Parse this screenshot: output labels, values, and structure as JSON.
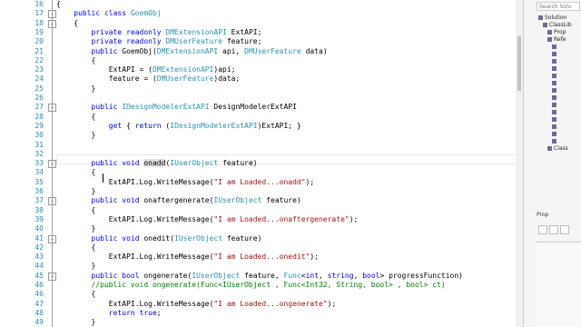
{
  "editor": {
    "lines": [
      {
        "n": "16",
        "html": "{"
      },
      {
        "n": "17",
        "html": "    <span class='kw'>public class</span> <span class='ty'>GoemObj</span>"
      },
      {
        "n": "18",
        "html": "    {"
      },
      {
        "n": "19",
        "html": "        <span class='kw'>private readonly</span> <span class='ty'>DMExtensionAPI</span> ExtAPI;"
      },
      {
        "n": "20",
        "html": "        <span class='kw'>private readonly</span> <span class='ty'>DMUserFeature</span> feature;"
      },
      {
        "n": "21",
        "html": "        <span class='kw'>public</span> GoemObj(<span class='ty'>DMExtensionAPI</span> api, <span class='ty'>DMUserFeature</span> data)"
      },
      {
        "n": "22",
        "html": "        {"
      },
      {
        "n": "23",
        "html": "            ExtAPI = (<span class='ty'>DMExtensionAPI</span>)api;"
      },
      {
        "n": "24",
        "html": "            feature = (<span class='ty'>DMUserFeature</span>)data;"
      },
      {
        "n": "25",
        "html": "        }"
      },
      {
        "n": "26",
        "html": ""
      },
      {
        "n": "27",
        "html": "        <span class='kw'>public</span> <span class='ty'>IDesignModelerExtAPI</span> DesignModelerExtAPI"
      },
      {
        "n": "28",
        "html": "        {"
      },
      {
        "n": "29",
        "html": "            <span class='kw'>get</span> { <span class='kw'>return</span> (<span class='ty'>IDesignModelerExtAPI</span>)ExtAPI; }"
      },
      {
        "n": "30",
        "html": "        }"
      },
      {
        "n": "31",
        "html": ""
      },
      {
        "n": "32",
        "html": ""
      },
      {
        "n": "33",
        "html": "        <span class='kw'>public void</span> <span class='hl'>onadd</span>(<span class='ty'>IUserObject</span> feature)"
      },
      {
        "n": "34",
        "html": "        {"
      },
      {
        "n": "35",
        "html": "            ExtAPI.Log.WriteMessage(<span class='st'>\"I am Loaded...onadd\"</span>);"
      },
      {
        "n": "36",
        "html": "        }"
      },
      {
        "n": "37",
        "html": "        <span class='kw'>public void</span> onaftergenerate(<span class='ty'>IUserObject</span> feature)"
      },
      {
        "n": "38",
        "html": "        {"
      },
      {
        "n": "39",
        "html": "            ExtAPI.Log.WriteMessage(<span class='st'>\"I am Loaded...onaftergenerate\"</span>);"
      },
      {
        "n": "40",
        "html": "        }"
      },
      {
        "n": "41",
        "html": "        <span class='kw'>public void</span> onedit(<span class='ty'>IUserObject</span> feature)"
      },
      {
        "n": "42",
        "html": "        {"
      },
      {
        "n": "43",
        "html": "            ExtAPI.Log.WriteMessage(<span class='st'>\"I am Loaded...onedit\"</span>);"
      },
      {
        "n": "44",
        "html": "        }"
      },
      {
        "n": "45",
        "html": "        <span class='kw'>public bool</span> ongenerate(<span class='ty'>IUserObject</span> feature, <span class='ty'>Func</span>&lt;<span class='kw'>int</span>, <span class='kw'>string</span>, <span class='kw'>bool</span>&gt; progressFunction)"
      },
      {
        "n": "46",
        "html": "        <span class='cm'>//public void ongenerate(Func&lt;IUserObject , Func&lt;Int32, String, bool&gt; , bool&gt; ct)</span>"
      },
      {
        "n": "46",
        "html": "        {"
      },
      {
        "n": "47",
        "html": "            ExtAPI.Log.WriteMessage(<span class='st'>\"I am Loaded...ongenerate\"</span>);"
      },
      {
        "n": "48",
        "html": "            <span class='kw'>return true</span>;"
      },
      {
        "n": "49",
        "html": "        }"
      }
    ]
  },
  "sidepanel": {
    "search_placeholder": "Search Solu",
    "tree": [
      {
        "label": "Solution",
        "indent": 0
      },
      {
        "label": "ClassLib",
        "indent": 1
      },
      {
        "label": "Prop",
        "indent": 2
      },
      {
        "label": "Refe",
        "indent": 2
      },
      {
        "label": "",
        "indent": 3
      },
      {
        "label": "",
        "indent": 3
      },
      {
        "label": "",
        "indent": 3
      },
      {
        "label": "",
        "indent": 3
      },
      {
        "label": "",
        "indent": 3
      },
      {
        "label": "",
        "indent": 3
      },
      {
        "label": "",
        "indent": 3
      },
      {
        "label": "",
        "indent": 3
      },
      {
        "label": "",
        "indent": 3
      },
      {
        "label": "",
        "indent": 3
      },
      {
        "label": "",
        "indent": 3
      },
      {
        "label": "",
        "indent": 3
      },
      {
        "label": "",
        "indent": 3
      },
      {
        "label": "",
        "indent": 3
      },
      {
        "label": "Class",
        "indent": 2
      }
    ],
    "properties_title": "Prop"
  }
}
